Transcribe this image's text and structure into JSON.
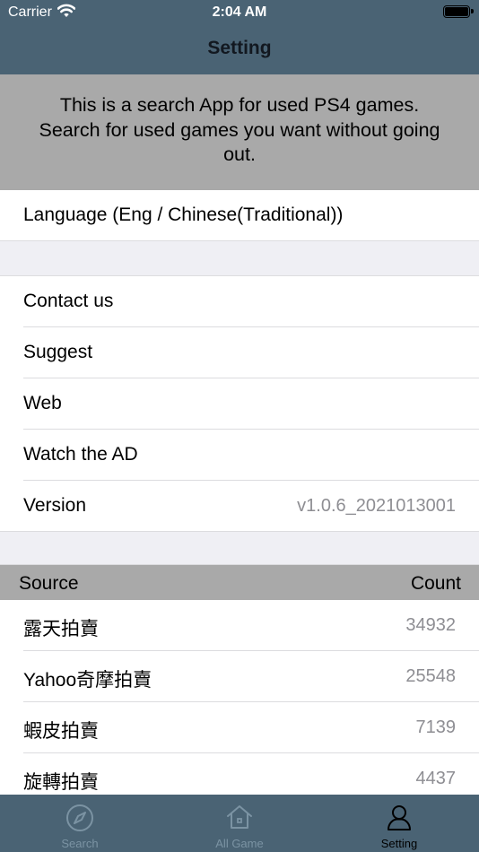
{
  "status_bar": {
    "carrier": "Carrier",
    "time": "2:04 AM"
  },
  "nav": {
    "title": "Setting"
  },
  "intro": {
    "text": "This is a search App for used PS4 games. Search for used games you want without going out."
  },
  "settings": {
    "language": "Language (Eng / Chinese(Traditional))",
    "contact": "Contact us",
    "suggest": "Suggest",
    "web": "Web",
    "watch_ad": "Watch the AD",
    "version_label": "Version",
    "version_value": "v1.0.6_2021013001"
  },
  "table": {
    "header_source": "Source",
    "header_count": "Count",
    "rows": [
      {
        "source": "露天拍賣",
        "count": "34932"
      },
      {
        "source": "Yahoo奇摩拍賣",
        "count": "25548"
      },
      {
        "source": "蝦皮拍賣",
        "count": "7139"
      },
      {
        "source": "旋轉拍賣",
        "count": "4437"
      }
    ]
  },
  "tab_bar": {
    "tabs": [
      {
        "label": "Search",
        "icon": "compass-icon",
        "active": false
      },
      {
        "label": "All Game",
        "icon": "home-icon",
        "active": false
      },
      {
        "label": "Setting",
        "icon": "person-icon",
        "active": true
      }
    ]
  },
  "colors": {
    "bar": "#4a6374",
    "gray_band": "#a9a9a9",
    "inactive_tab": "#7b93a3"
  }
}
